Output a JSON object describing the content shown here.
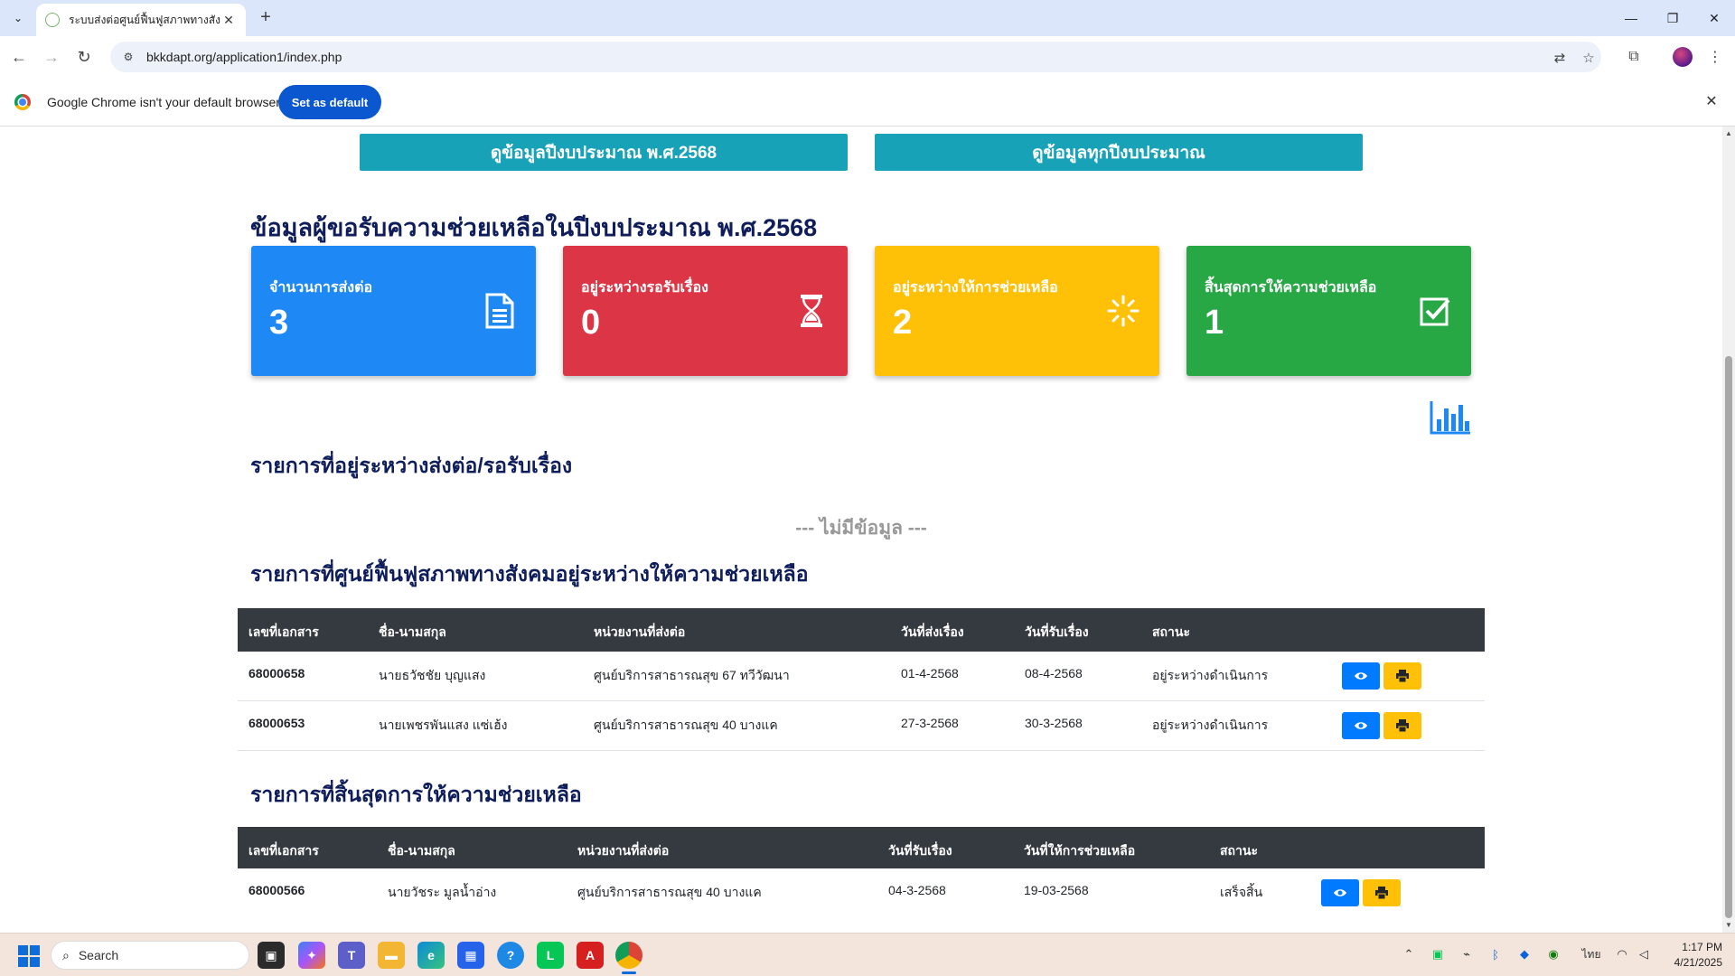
{
  "browser": {
    "tab_title": "ระบบส่งต่อศูนย์ฟื้นฟูสภาพทางสังคม",
    "url": "bkkdapt.org/application1/index.php",
    "infobar_text": "Google Chrome isn't your default browser",
    "set_default_label": "Set as default"
  },
  "top_buttons": {
    "current_year": "ดูข้อมูลปีงบประมาณ พ.ศ.2568",
    "all_years": "ดูข้อมูลทุกปีงบประมาณ"
  },
  "summary": {
    "title": "ข้อมูลผู้ขอรับความช่วยเหลือในปีงบประมาณ พ.ศ.2568",
    "cards": [
      {
        "label": "จำนวนการส่งต่อ",
        "count": "3",
        "color": "#1e88f5",
        "icon": "document-icon"
      },
      {
        "label": "อยู่ระหว่างรอรับเรื่อง",
        "count": "0",
        "color": "#dc3545",
        "icon": "hourglass-icon"
      },
      {
        "label": "อยู่ระหว่างให้การช่วยเหลือ",
        "count": "2",
        "color": "#ffc107",
        "icon": "spinner-icon"
      },
      {
        "label": "สิ้นสุดการให้ความช่วยเหลือ",
        "count": "1",
        "color": "#28a745",
        "icon": "checkbox-icon"
      }
    ]
  },
  "pending": {
    "title": "รายการที่อยู่ระหว่างส่งต่อ/รอรับเรื่อง",
    "empty_text": "--- ไม่มีข้อมูล ---"
  },
  "in_progress": {
    "title": "รายการที่ศูนย์ฟื้นฟูสภาพทางสังคมอยู่ระหว่างให้ความช่วยเหลือ",
    "headers": [
      "เลขที่เอกสาร",
      "ชื่อ-นามสกุล",
      "หน่วยงานที่ส่งต่อ",
      "วันที่ส่งเรื่อง",
      "วันที่รับเรื่อง",
      "สถานะ"
    ],
    "rows": [
      [
        "68000658",
        "นายธวัชชัย บุญแสง",
        "ศูนย์บริการสาธารณสุข 67 ทวีวัฒนา",
        "01-4-2568",
        "08-4-2568",
        "อยู่ระหว่างดำเนินการ"
      ],
      [
        "68000653",
        "นายเพชรพันแสง แซ่เฮ้ง",
        "ศูนย์บริการสาธารณสุข 40 บางแค",
        "27-3-2568",
        "30-3-2568",
        "อยู่ระหว่างดำเนินการ"
      ]
    ]
  },
  "completed": {
    "title": "รายการที่สิ้นสุดการให้ความช่วยเหลือ",
    "headers": [
      "เลขที่เอกสาร",
      "ชื่อ-นามสกุล",
      "หน่วยงานที่ส่งต่อ",
      "วันที่รับเรื่อง",
      "วันที่ให้การช่วยเหลือ",
      "สถานะ"
    ],
    "rows": [
      [
        "68000566",
        "นายวัชระ มูลน้ำอ่าง",
        "ศูนย์บริการสาธารณสุข 40 บางแค",
        "04-3-2568",
        "19-03-2568",
        "เสร็จสิ้น"
      ]
    ]
  },
  "taskbar": {
    "search_placeholder": "Search",
    "time": "1:17 PM",
    "date": "4/21/2025",
    "language": "ไทย"
  }
}
